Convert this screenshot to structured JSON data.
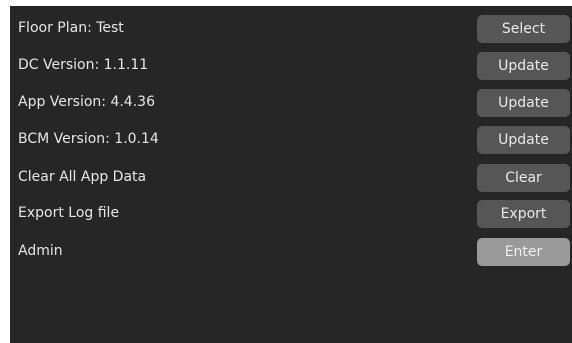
{
  "settings": {
    "rows": [
      {
        "label": "Floor Plan:  Test",
        "button": "Select"
      },
      {
        "label": "DC Version:  1.1.11",
        "button": "Update"
      },
      {
        "label": "App Version:  4.4.36",
        "button": "Update"
      },
      {
        "label": "BCM Version:  1.0.14",
        "button": "Update"
      },
      {
        "label": "Clear All App Data",
        "button": "Clear"
      },
      {
        "label": "Export Log file",
        "button": "Export"
      },
      {
        "label": "Admin",
        "button": "Enter"
      }
    ]
  },
  "colors": {
    "background": "#262626",
    "button": "#565656",
    "button_active": "#9a9a9a",
    "text": "#e6e6e6"
  }
}
